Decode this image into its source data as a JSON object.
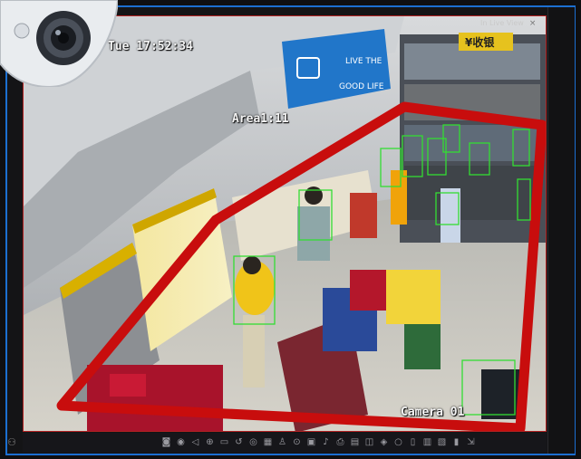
{
  "window": {
    "header_label": "In Live View",
    "close_glyph": "×"
  },
  "overlay": {
    "timestamp": "Tue 17:52:34",
    "area_label": "Area1:11",
    "camera_label": "Camera 01"
  },
  "scene": {
    "banner_text_1": "LIVE THE",
    "banner_text_2": "GOOD LIFE",
    "sign_text": "¥收银",
    "zone_color": "#c80d0d",
    "box_color": "#33dd33",
    "border_color": "#1c6fd1"
  },
  "toolbar": {
    "left_icon": "user-tree-icon",
    "icons": [
      "camera-icon",
      "record-icon",
      "audio-icon",
      "zoom-icon",
      "ptz-icon",
      "rewind-icon",
      "fisheye-icon",
      "grid-icon",
      "person-icon",
      "playback-icon",
      "display-icon",
      "mic-icon",
      "print-icon",
      "image-icon",
      "window-icon",
      "shield-icon",
      "bulb-icon",
      "doc-icon",
      "chart-icon",
      "layers-icon",
      "bookmark-icon",
      "export-icon"
    ]
  }
}
